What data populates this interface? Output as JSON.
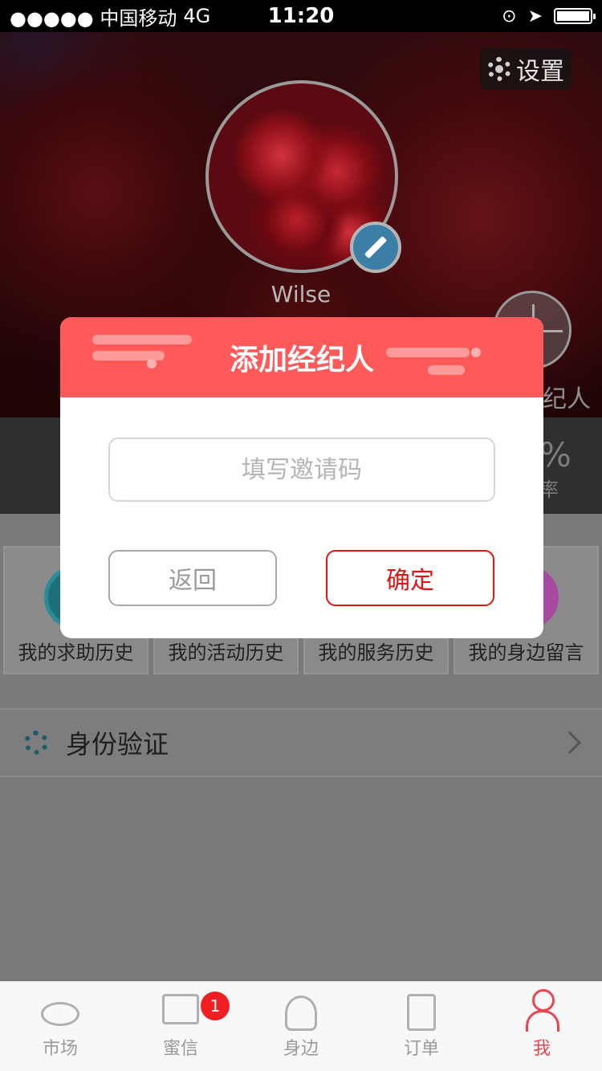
{
  "status_bar": {
    "carrier": "●●●●● 中国移动",
    "network": "4G",
    "time": "11:20"
  },
  "header": {
    "settings_label": "设置",
    "username": "Wilse",
    "agent_label": "纪人"
  },
  "stats": {
    "value": "%",
    "label": "率"
  },
  "grid": [
    {
      "label": "我的求助历史",
      "icon": "help-history-icon"
    },
    {
      "label": "我的活动历史",
      "icon": "activity-history-icon"
    },
    {
      "label": "我的服务历史",
      "icon": "service-history-icon"
    },
    {
      "label": "我的身边留言",
      "icon": "nearby-message-icon"
    }
  ],
  "verify_row": {
    "label": "身份验证"
  },
  "tabbar": {
    "tabs": [
      {
        "label": "市场",
        "active": false
      },
      {
        "label": "蜜信",
        "active": false,
        "badge": "1"
      },
      {
        "label": "身边",
        "active": false
      },
      {
        "label": "订单",
        "active": false
      },
      {
        "label": "我",
        "active": true
      }
    ]
  },
  "dialog": {
    "title": "添加经纪人",
    "input_placeholder": "填写邀请码",
    "input_value": "",
    "cancel_label": "返回",
    "confirm_label": "确定"
  },
  "colors": {
    "accent": "#ff5a5a",
    "confirm": "#e01515",
    "active_tab": "#e8474f",
    "badge": "#f01d22"
  }
}
